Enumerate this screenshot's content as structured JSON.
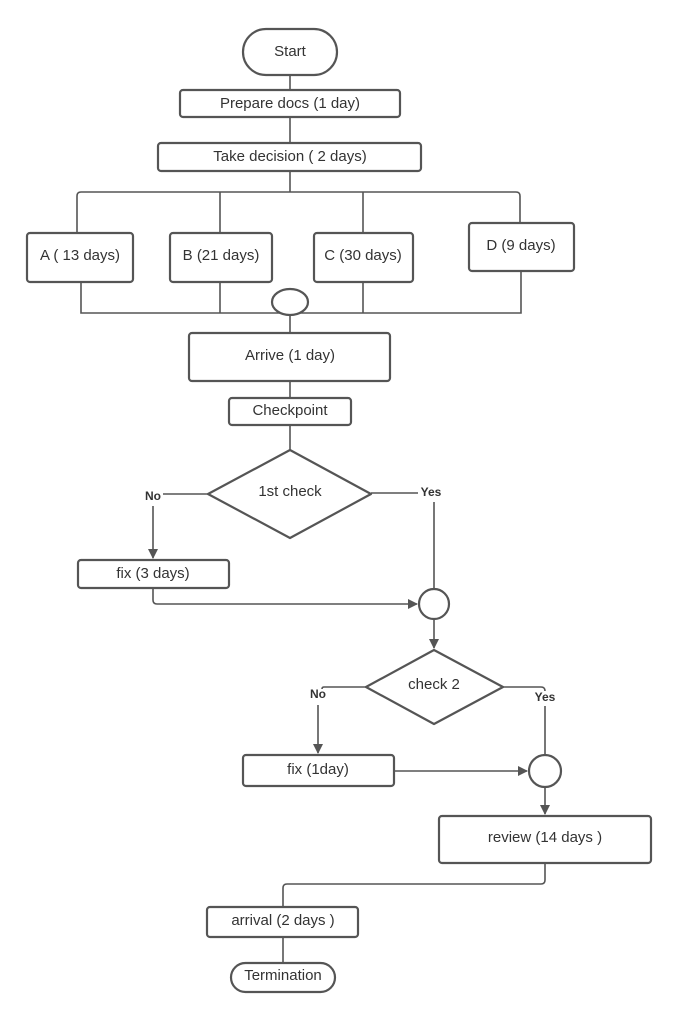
{
  "nodes": {
    "start": "Start",
    "prepare": "Prepare docs (1 day)",
    "decision": "Take decision ( 2 days)",
    "a": "A ( 13 days)",
    "b": "B (21 days)",
    "c": "C (30 days)",
    "d": "D (9 days)",
    "arrive": "Arrive (1 day)",
    "checkpoint": "Checkpoint",
    "check1": "1st check",
    "fix1": "fix (3 days)",
    "check2": "check 2",
    "fix2": "fix (1day)",
    "review": "review (14 days )",
    "arrival": "arrival (2 days )",
    "termination": "Termination"
  },
  "labels": {
    "no": "No",
    "yes": "Yes"
  },
  "colors": {
    "stroke": "#555555",
    "text": "#333333"
  }
}
